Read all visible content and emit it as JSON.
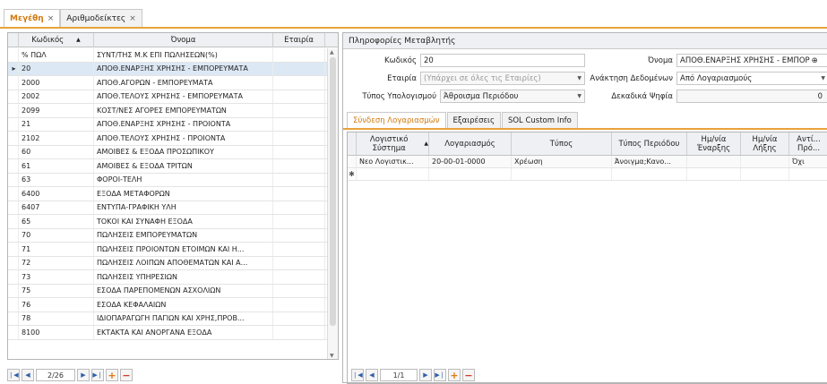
{
  "tabs": [
    {
      "label": "Μεγέθη",
      "close": "×"
    },
    {
      "label": "Αριθμοδείκτες",
      "close": "×"
    }
  ],
  "list": {
    "columns": [
      "Κωδικός",
      "Όνομα",
      "Εταιρία"
    ],
    "sort_indicator": "▲",
    "rows": [
      {
        "code": "% ΠΩΛ",
        "name": "ΣΥΝΤ/ΤΗΣ Μ.Κ ΕΠΙ ΠΩΛΗΣΕΩΝ(%)",
        "company": ""
      },
      {
        "code": "20",
        "name": "ΑΠΟΘ.ΕΝΑΡΞΗΣ ΧΡΗΣΗΣ - ΕΜΠΟΡΕΥΜΑΤΑ",
        "company": "",
        "selected": true
      },
      {
        "code": "2000",
        "name": "ΑΠΟΘ.ΑΓΟΡΩΝ - ΕΜΠΟΡΕΥΜΑΤΑ",
        "company": ""
      },
      {
        "code": "2002",
        "name": "ΑΠΟΘ.ΤΕΛΟΥΣ ΧΡΗΣΗΣ - ΕΜΠΟΡΕΥΜΑΤΑ",
        "company": ""
      },
      {
        "code": "2099",
        "name": "ΚΟΣΤ/ΝΕΣ ΑΓΟΡΕΣ ΕΜΠΟΡΕΥΜΑΤΩΝ",
        "company": ""
      },
      {
        "code": "21",
        "name": "ΑΠΟΘ.ΕΝΑΡΞΗΣ ΧΡΗΣΗΣ - ΠΡΟΙΟΝΤΑ",
        "company": ""
      },
      {
        "code": "2102",
        "name": "ΑΠΟΘ.ΤΕΛΟΥΣ ΧΡΗΣΗΣ - ΠΡΟΙΟΝΤΑ",
        "company": ""
      },
      {
        "code": "60",
        "name": "ΑΜΟΙΒΕΣ & ΕΞΟΔΑ ΠΡΟΣΩΠΙΚΟΥ",
        "company": ""
      },
      {
        "code": "61",
        "name": "ΑΜΟΙΒΕΣ & ΕΞΟΔΑ ΤΡΙΤΩΝ",
        "company": ""
      },
      {
        "code": "63",
        "name": "ΦΟΡΟΙ-ΤΕΛΗ",
        "company": ""
      },
      {
        "code": "6400",
        "name": "ΕΞΟΔΑ ΜΕΤΑΦΟΡΩΝ",
        "company": ""
      },
      {
        "code": "6407",
        "name": "ΕΝΤΥΠΑ-ΓΡΑΦΙΚΗ ΥΛΗ",
        "company": ""
      },
      {
        "code": "65",
        "name": "ΤΟΚΟΙ ΚΑΙ ΣΥΝΑΦΗ ΕΞΟΔΑ",
        "company": ""
      },
      {
        "code": "70",
        "name": "ΠΩΛΗΣΕΙΣ ΕΜΠΟΡΕΥΜΑΤΩΝ",
        "company": ""
      },
      {
        "code": "71",
        "name": "ΠΩΛΗΣΕΙΣ ΠΡΟΙΟΝΤΩΝ ΕΤΟΙΜΩΝ ΚΑΙ Η...",
        "company": ""
      },
      {
        "code": "72",
        "name": "ΠΩΛΗΣΕΙΣ ΛΟΙΠΩΝ ΑΠΟΘΕΜΑΤΩΝ ΚΑΙ Α...",
        "company": ""
      },
      {
        "code": "73",
        "name": "ΠΩΛΗΣΕΙΣ ΥΠΗΡΕΣΙΩΝ",
        "company": ""
      },
      {
        "code": "75",
        "name": "ΕΣΟΔΑ ΠΑΡΕΠΟΜΕΝΩΝ ΑΣΧΟΛΙΩΝ",
        "company": ""
      },
      {
        "code": "76",
        "name": "ΕΣΟΔΑ ΚΕΦΑΛΑΙΩΝ",
        "company": ""
      },
      {
        "code": "78",
        "name": "ΙΔΙΟΠΑΡΑΓΩΓΗ ΠΑΓΙΩΝ ΚΑΙ ΧΡΗΣ,ΠΡΟΒ...",
        "company": ""
      },
      {
        "code": "8100",
        "name": "ΕΚΤΑΚΤΑ ΚΑΙ ΑΝΟΡΓΑΝΑ ΕΞΟΔΑ",
        "company": ""
      }
    ],
    "pager": "2/26",
    "selected_marker": "▸"
  },
  "panel": {
    "title": "Πληροφορίες Μεταβλητής",
    "code_label": "Κωδικός",
    "code_value": "20",
    "name_label": "Όνομα",
    "name_value": "ΑΠΟΘ.ΕΝΑΡΞΗΣ ΧΡΗΣΗΣ - ΕΜΠΟΡ",
    "company_label": "Εταιρία",
    "company_placeholder": "(Υπάρχει σε όλες τις Εταιρίες)",
    "retrieval_label": "Ανάκτηση Δεδομένων",
    "retrieval_value": "Από Λογαριασμούς",
    "calc_label": "Τύπος Υπολογισμού",
    "calc_value": "Άθροισμα Περιόδου",
    "decimals_label": "Δεκαδικά Ψηφία",
    "decimals_value": "0"
  },
  "subtabs": [
    "Σύνδεση Λογαριασμών",
    "Εξαιρέσεις",
    "SOL Custom Info"
  ],
  "accounts": {
    "columns": [
      "Λογιστικό Σύστημα",
      "Λογαριασμός",
      "Τύπος",
      "Τύπος Περιόδου",
      "Ημ/νία Έναρξης",
      "Ημ/νία Λήξης",
      "Αντί... Πρό..."
    ],
    "rows": [
      {
        "system": "Νεο Λογιστικ...",
        "account": "20-00-01-0000",
        "type": "Χρέωση",
        "period": "Άνοιγμα;Κανο...",
        "start": "",
        "end": "",
        "opposite": "Όχι"
      }
    ],
    "new_row_marker": "✱",
    "pager": "1/1"
  }
}
